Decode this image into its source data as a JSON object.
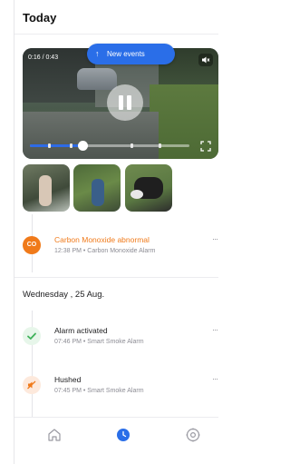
{
  "header": {
    "title": "Today"
  },
  "video": {
    "time_code": "0:16 / 0:43",
    "progress": 0.33,
    "new_events_label": "New events",
    "icons": {
      "mute": "mute-icon",
      "pause": "pause-icon",
      "fullscreen": "fullscreen-icon",
      "arrow": "arrow-up-icon"
    }
  },
  "thumbnails": [
    {
      "name": "thumbnail-1"
    },
    {
      "name": "thumbnail-2"
    },
    {
      "name": "thumbnail-3"
    }
  ],
  "events_today": [
    {
      "icon_text": "CO",
      "title": "Carbon Monoxide abnormal",
      "subtitle": "12:38 PM • Carbon Monoxide Alarm",
      "more": "···",
      "accent": "#f07a1a"
    }
  ],
  "day_header": "Wednesday , 25 Aug.",
  "events_day": [
    {
      "title": "Alarm activated",
      "subtitle": "07:46 PM • Smart Smoke Alarm",
      "more": "···",
      "icon": "check-icon",
      "accent": "#3fb25a"
    },
    {
      "title": "Hushed",
      "subtitle": "07:45 PM • Smart Smoke Alarm",
      "more": "···",
      "icon": "hush-icon",
      "accent": "#f07a1a"
    }
  ],
  "tabs": [
    {
      "name": "home",
      "icon": "home-icon"
    },
    {
      "name": "history",
      "icon": "clock-icon",
      "active": true
    },
    {
      "name": "settings",
      "icon": "gear-icon"
    }
  ],
  "colors": {
    "accent": "#2a6ee8",
    "warning": "#f07a1a",
    "success": "#3fb25a"
  }
}
